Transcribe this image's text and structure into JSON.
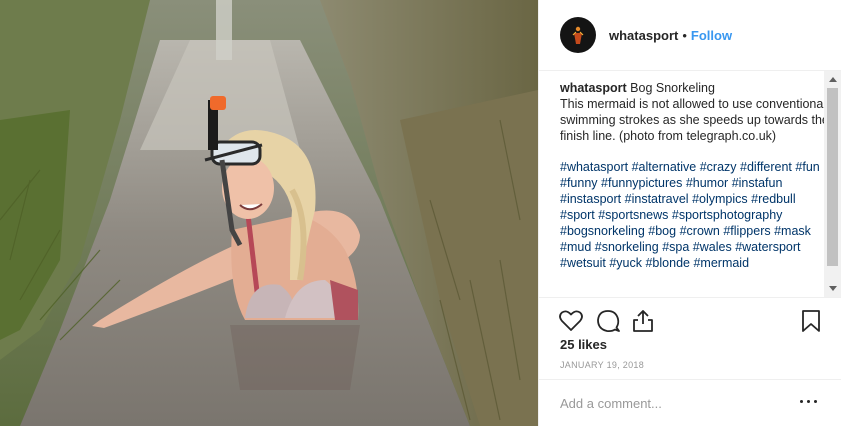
{
  "post": {
    "photo_description_icon": "photo",
    "username": "whatasport",
    "separator": "•",
    "follow_label": "Follow"
  },
  "caption": {
    "username": "whatasport",
    "title": "Bog Snorkeling",
    "body": "This mermaid is not allowed to use conventional swimming strokes as she speeds up towards the finish line. (photo from telegraph.co.uk)",
    "hashtags": [
      "#whatasport",
      "#alternative",
      "#crazy",
      "#different",
      "#fun",
      "#funny",
      "#funnypictures",
      "#humor",
      "#instafun",
      "#instasport",
      "#instatravel",
      "#olympics",
      "#redbull",
      "#sport",
      "#sportsnews",
      "#sportsphotography",
      "#bogsnorkeling",
      "#bog",
      "#crown",
      "#flippers",
      "#mask",
      "#mud",
      "#snorkeling",
      "#spa",
      "#wales",
      "#watersport",
      "#wetsuit",
      "#yuck",
      "#blonde",
      "#mermaid"
    ]
  },
  "actions": {
    "like_icon": "heart-icon",
    "comment_icon": "comment-icon",
    "share_icon": "share-icon",
    "save_icon": "bookmark-icon"
  },
  "likes": "25 likes",
  "date": "JANUARY 19, 2018",
  "comment": {
    "placeholder": "Add a comment...",
    "more_icon": "more-options-icon"
  }
}
